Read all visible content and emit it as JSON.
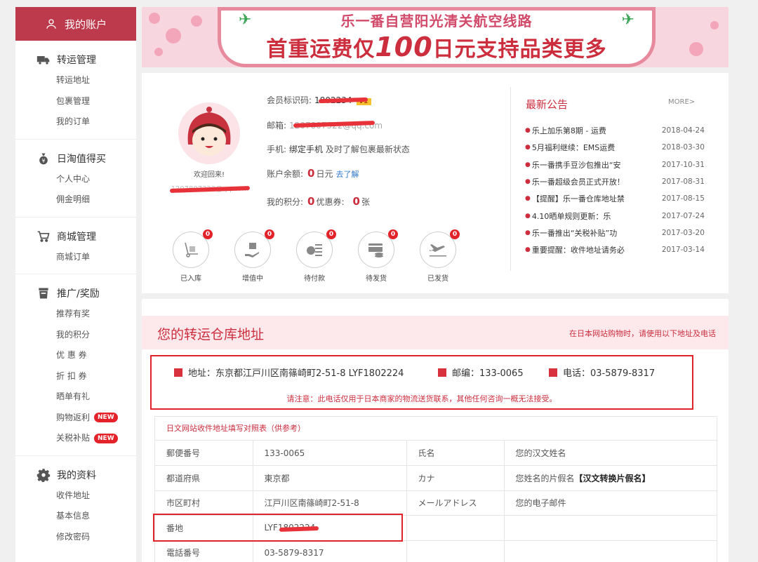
{
  "sidebar": {
    "header": "我的账户",
    "sections": [
      {
        "title": "转运管理",
        "icon": "truck-icon",
        "items": [
          {
            "label": "转运地址"
          },
          {
            "label": "包裹管理"
          },
          {
            "label": "我的订单"
          }
        ]
      },
      {
        "title": "日淘值得买",
        "icon": "money-bag-icon",
        "items": [
          {
            "label": "个人中心"
          },
          {
            "label": "佣金明细"
          }
        ]
      },
      {
        "title": "商城管理",
        "icon": "cart-icon",
        "items": [
          {
            "label": "商城订单"
          }
        ]
      },
      {
        "title": "推广/奖励",
        "icon": "trash-bin-icon",
        "items": [
          {
            "label": "推荐有奖"
          },
          {
            "label": "我的积分"
          },
          {
            "label": "优 惠 券"
          },
          {
            "label": "折 扣 券"
          },
          {
            "label": "晒单有礼"
          },
          {
            "label": "购物返利",
            "badge": "NEW"
          },
          {
            "label": "关税补贴",
            "badge": "NEW"
          }
        ]
      },
      {
        "title": "我的资料",
        "icon": "gear-icon",
        "items": [
          {
            "label": "收件地址"
          },
          {
            "label": "基本信息"
          },
          {
            "label": "修改密码"
          }
        ]
      }
    ]
  },
  "banner": {
    "line1": "乐一番自营阳光清关航空线路",
    "line2_pre": "首重运费仅",
    "line2_num": "100",
    "line2_post": "日元支持品类更多"
  },
  "account": {
    "welcome": "欢迎回来!",
    "user_email": "1207807322@qq.com",
    "member_id_label": "会员标识码:",
    "member_id": "1802234",
    "vip": "V1",
    "email_label": "邮箱:",
    "email": "1207807322@qq.com",
    "phone_label": "手机:",
    "phone_bind": "绑定手机",
    "phone_hint": "及时了解包裹最新状态",
    "balance_label": "账户余额:",
    "balance": "0",
    "balance_unit": "日元",
    "balance_link": "去了解",
    "points_label": "我的积分:",
    "points": "0",
    "coupon_label": "优惠券:",
    "coupons": "0",
    "coupon_unit": "张",
    "stats": [
      {
        "label": "已入库",
        "count": "0",
        "icon": "hand-truck-icon"
      },
      {
        "label": "增值中",
        "count": "0",
        "icon": "hand-package-icon"
      },
      {
        "label": "待付款",
        "count": "0",
        "icon": "payment-list-icon"
      },
      {
        "label": "待发货",
        "count": "0",
        "icon": "card-coins-icon"
      },
      {
        "label": "已发货",
        "count": "0",
        "icon": "airplane-icon"
      }
    ]
  },
  "notices": {
    "title": "最新公告",
    "more": "MORE>",
    "items": [
      {
        "title": "乐上加乐第8期 - 运费",
        "date": "2018-04-24"
      },
      {
        "title": "5月福利继续：EMS运费",
        "date": "2018-03-30"
      },
      {
        "title": "乐一番携手豆沙包推出“安",
        "date": "2017-10-31"
      },
      {
        "title": "乐一番超级会员正式开放！",
        "date": "2017-08-31"
      },
      {
        "title": "【提醒】乐一番仓库地址禁",
        "date": "2017-08-15"
      },
      {
        "title": "4.10晒单规则更新：乐",
        "date": "2017-07-24"
      },
      {
        "title": "乐一番推出“关税补贴”功",
        "date": "2017-03-20"
      },
      {
        "title": "重要提醒：收件地址请务必",
        "date": "2017-03-14"
      }
    ]
  },
  "warehouse": {
    "title": "您的转运仓库地址",
    "subtitle": "在日本网站购物时，请使用以下地址及电话",
    "address_label": "地址：东京都江戸川区南篠崎町2-51-8 LYF1802224",
    "zip_label": "邮编：133-0065",
    "tel_label": "电话：03-5879-8317",
    "note": "请注意：此电话仅用于日本商家的物流送货联系，其他任何咨询一概无法接受。",
    "ref_title": "日文网站收件地址填写对照表（供参考）",
    "rows": [
      [
        "郵便番号",
        "133-0065",
        "氏名",
        "您的汉文姓名"
      ],
      [
        "都道府県",
        "東京都",
        "カナ",
        "您姓名的片假名"
      ],
      [
        "市区町村",
        "江戸川区南篠崎町2-51-8",
        "メールアドレス",
        "您的电子邮件"
      ],
      [
        "番地",
        "LYF1802224",
        "",
        ""
      ],
      [
        "電話番号",
        "03-5879-8317",
        "",
        ""
      ]
    ],
    "kana_tool": "【汉文转换片假名】"
  }
}
